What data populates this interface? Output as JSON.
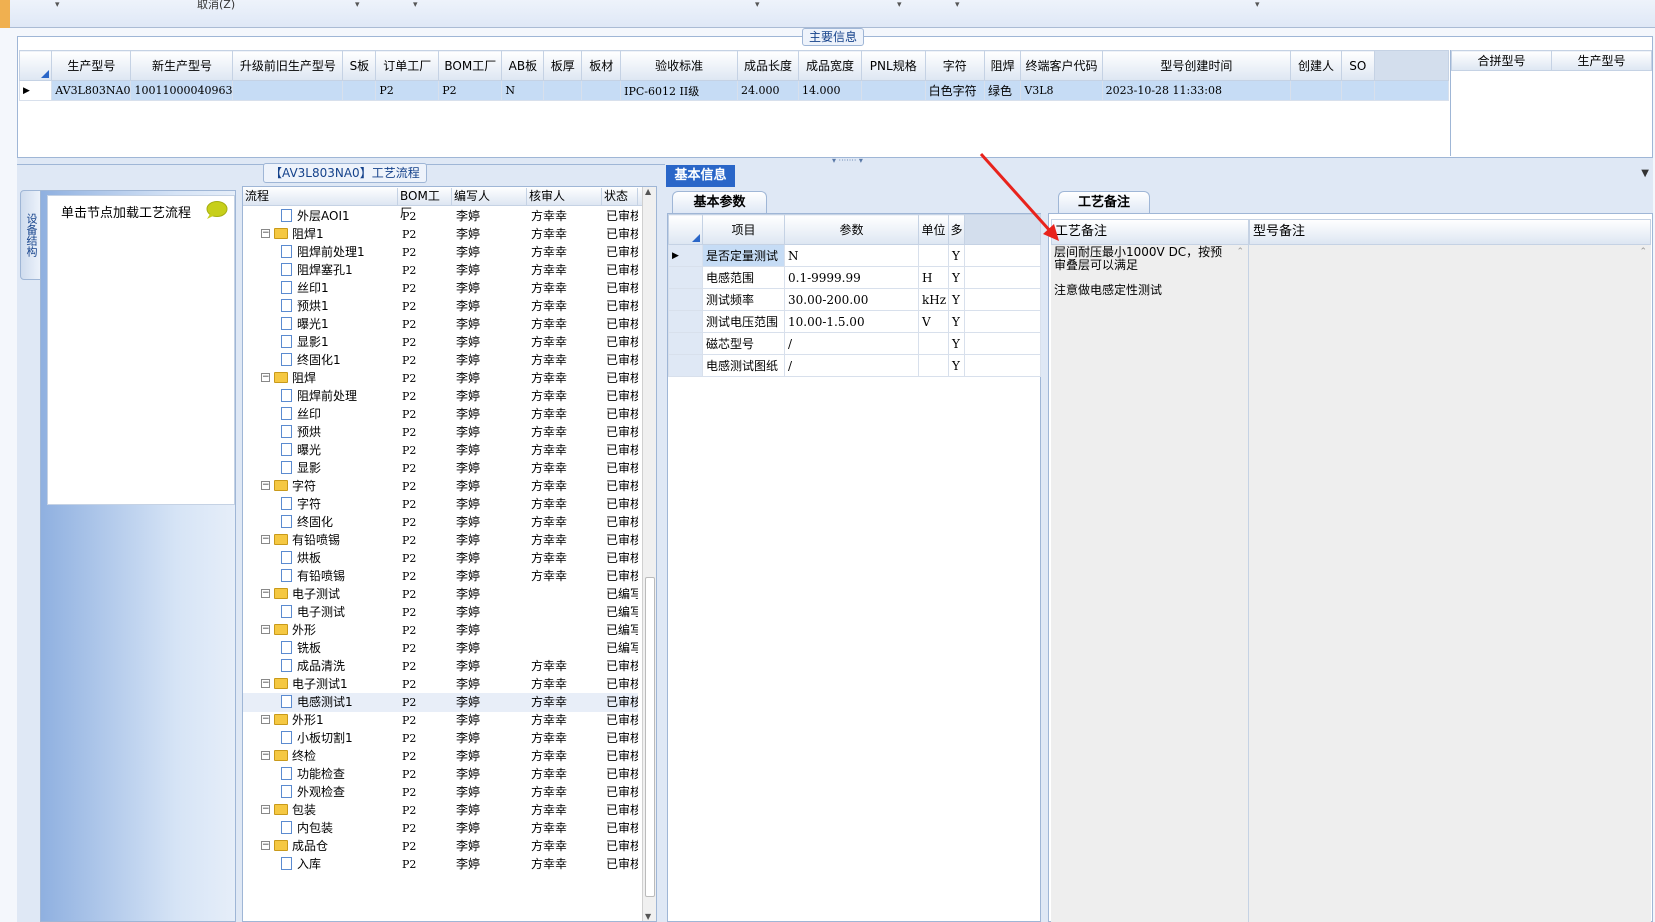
{
  "toolbar": {
    "cancel_label": "取消(Z)"
  },
  "main_info": {
    "title": "主要信息",
    "columns": [
      "生产型号",
      "新生产型号",
      "升级前旧生产型号",
      "S板",
      "订单工厂",
      "BOM工厂",
      "AB板",
      "板厚",
      "板材",
      "验收标准",
      "成品长度",
      "成品宽度",
      "PNL规格",
      "字符",
      "阻焊",
      "终端客户代码",
      "型号创建时间",
      "创建人",
      "SO"
    ],
    "row": [
      "AV3L803NA0",
      "10011000040963",
      "",
      "",
      "P2",
      "P2",
      "N",
      "",
      "",
      "IPC-6012 II级",
      "24.000",
      "14.000",
      "",
      "白色字符",
      "绿色",
      "V3L8",
      "2023-10-28 11:33:08",
      "",
      ""
    ],
    "merge_columns": [
      "合拼型号",
      "生产型号"
    ]
  },
  "side": {
    "vertical_tab": "设备结构",
    "load_label": "单击节点加载工艺流程"
  },
  "tree": {
    "title": "【AV3L803NA0】工艺流程",
    "columns": [
      "流程",
      "BOM工厂",
      "编写人",
      "核审人",
      "状态"
    ],
    "rows": [
      {
        "name": "外层AOI1",
        "level": 2,
        "folder": false,
        "bom": "P2",
        "writer": "李婷",
        "reviewer": "方幸幸",
        "status": "已审核"
      },
      {
        "name": "阻焊1",
        "level": 1,
        "folder": true,
        "bom": "P2",
        "writer": "李婷",
        "reviewer": "方幸幸",
        "status": "已审核"
      },
      {
        "name": "阻焊前处理1",
        "level": 2,
        "folder": false,
        "bom": "P2",
        "writer": "李婷",
        "reviewer": "方幸幸",
        "status": "已审核"
      },
      {
        "name": "阻焊塞孔1",
        "level": 2,
        "folder": false,
        "bom": "P2",
        "writer": "李婷",
        "reviewer": "方幸幸",
        "status": "已审核"
      },
      {
        "name": "丝印1",
        "level": 2,
        "folder": false,
        "bom": "P2",
        "writer": "李婷",
        "reviewer": "方幸幸",
        "status": "已审核"
      },
      {
        "name": "预烘1",
        "level": 2,
        "folder": false,
        "bom": "P2",
        "writer": "李婷",
        "reviewer": "方幸幸",
        "status": "已审核"
      },
      {
        "name": "曝光1",
        "level": 2,
        "folder": false,
        "bom": "P2",
        "writer": "李婷",
        "reviewer": "方幸幸",
        "status": "已审核"
      },
      {
        "name": "显影1",
        "level": 2,
        "folder": false,
        "bom": "P2",
        "writer": "李婷",
        "reviewer": "方幸幸",
        "status": "已审核"
      },
      {
        "name": "终固化1",
        "level": 2,
        "folder": false,
        "bom": "P2",
        "writer": "李婷",
        "reviewer": "方幸幸",
        "status": "已审核"
      },
      {
        "name": "阻焊",
        "level": 1,
        "folder": true,
        "bom": "P2",
        "writer": "李婷",
        "reviewer": "方幸幸",
        "status": "已审核"
      },
      {
        "name": "阻焊前处理",
        "level": 2,
        "folder": false,
        "bom": "P2",
        "writer": "李婷",
        "reviewer": "方幸幸",
        "status": "已审核"
      },
      {
        "name": "丝印",
        "level": 2,
        "folder": false,
        "bom": "P2",
        "writer": "李婷",
        "reviewer": "方幸幸",
        "status": "已审核"
      },
      {
        "name": "预烘",
        "level": 2,
        "folder": false,
        "bom": "P2",
        "writer": "李婷",
        "reviewer": "方幸幸",
        "status": "已审核"
      },
      {
        "name": "曝光",
        "level": 2,
        "folder": false,
        "bom": "P2",
        "writer": "李婷",
        "reviewer": "方幸幸",
        "status": "已审核"
      },
      {
        "name": "显影",
        "level": 2,
        "folder": false,
        "bom": "P2",
        "writer": "李婷",
        "reviewer": "方幸幸",
        "status": "已审核"
      },
      {
        "name": "字符",
        "level": 1,
        "folder": true,
        "bom": "P2",
        "writer": "李婷",
        "reviewer": "方幸幸",
        "status": "已审核"
      },
      {
        "name": "字符",
        "level": 2,
        "folder": false,
        "bom": "P2",
        "writer": "李婷",
        "reviewer": "方幸幸",
        "status": "已审核"
      },
      {
        "name": "终固化",
        "level": 2,
        "folder": false,
        "bom": "P2",
        "writer": "李婷",
        "reviewer": "方幸幸",
        "status": "已审核"
      },
      {
        "name": "有铅喷锡",
        "level": 1,
        "folder": true,
        "bom": "P2",
        "writer": "李婷",
        "reviewer": "方幸幸",
        "status": "已审核"
      },
      {
        "name": "烘板",
        "level": 2,
        "folder": false,
        "bom": "P2",
        "writer": "李婷",
        "reviewer": "方幸幸",
        "status": "已审核"
      },
      {
        "name": "有铅喷锡",
        "level": 2,
        "folder": false,
        "bom": "P2",
        "writer": "李婷",
        "reviewer": "方幸幸",
        "status": "已审核"
      },
      {
        "name": "电子测试",
        "level": 1,
        "folder": true,
        "bom": "P2",
        "writer": "李婷",
        "reviewer": "",
        "status": "已编写"
      },
      {
        "name": "电子测试",
        "level": 2,
        "folder": false,
        "bom": "P2",
        "writer": "李婷",
        "reviewer": "",
        "status": "已编写"
      },
      {
        "name": "外形",
        "level": 1,
        "folder": true,
        "bom": "P2",
        "writer": "李婷",
        "reviewer": "",
        "status": "已编写"
      },
      {
        "name": "铣板",
        "level": 2,
        "folder": false,
        "bom": "P2",
        "writer": "李婷",
        "reviewer": "",
        "status": "已编写"
      },
      {
        "name": "成品清洗",
        "level": 2,
        "folder": false,
        "bom": "P2",
        "writer": "李婷",
        "reviewer": "方幸幸",
        "status": "已审核"
      },
      {
        "name": "电子测试1",
        "level": 1,
        "folder": true,
        "bom": "P2",
        "writer": "李婷",
        "reviewer": "方幸幸",
        "status": "已审核"
      },
      {
        "name": "电感测试1",
        "level": 2,
        "folder": false,
        "bom": "P2",
        "writer": "李婷",
        "reviewer": "方幸幸",
        "status": "已审核",
        "selected": true
      },
      {
        "name": "外形1",
        "level": 1,
        "folder": true,
        "bom": "P2",
        "writer": "李婷",
        "reviewer": "方幸幸",
        "status": "已审核"
      },
      {
        "name": "小板切割1",
        "level": 2,
        "folder": false,
        "bom": "P2",
        "writer": "李婷",
        "reviewer": "方幸幸",
        "status": "已审核"
      },
      {
        "name": "终检",
        "level": 1,
        "folder": true,
        "bom": "P2",
        "writer": "李婷",
        "reviewer": "方幸幸",
        "status": "已审核"
      },
      {
        "name": "功能检查",
        "level": 2,
        "folder": false,
        "bom": "P2",
        "writer": "李婷",
        "reviewer": "方幸幸",
        "status": "已审核"
      },
      {
        "name": "外观检查",
        "level": 2,
        "folder": false,
        "bom": "P2",
        "writer": "李婷",
        "reviewer": "方幸幸",
        "status": "已审核"
      },
      {
        "name": "包装",
        "level": 1,
        "folder": true,
        "bom": "P2",
        "writer": "李婷",
        "reviewer": "方幸幸",
        "status": "已审核"
      },
      {
        "name": "内包装",
        "level": 2,
        "folder": false,
        "bom": "P2",
        "writer": "李婷",
        "reviewer": "方幸幸",
        "status": "已审核"
      },
      {
        "name": "成品仓",
        "level": 1,
        "folder": true,
        "bom": "P2",
        "writer": "李婷",
        "reviewer": "方幸幸",
        "status": "已审核"
      },
      {
        "name": "入库",
        "level": 2,
        "folder": false,
        "bom": "P2",
        "writer": "李婷",
        "reviewer": "方幸幸",
        "status": "已审核"
      }
    ]
  },
  "basic_info": {
    "tab": "基本信息",
    "params_tab": "基本参数",
    "columns": [
      "项目",
      "参数",
      "单位",
      "多"
    ],
    "rows": [
      {
        "item": "是否定量测试",
        "param": "N",
        "unit": "",
        "flag": "Y"
      },
      {
        "item": "电感范围",
        "param": "0.1-9999.99",
        "unit": "H",
        "flag": "Y"
      },
      {
        "item": "测试频率",
        "param": "30.00-200.00",
        "unit": "kHz",
        "flag": "Y"
      },
      {
        "item": "测试电压范围",
        "param": "10.00-1.5.00",
        "unit": "V",
        "flag": "Y"
      },
      {
        "item": "磁芯型号",
        "param": "/",
        "unit": "",
        "flag": "Y"
      },
      {
        "item": "电感测试图纸",
        "param": "/",
        "unit": "",
        "flag": "Y"
      }
    ]
  },
  "notes": {
    "tab": "工艺备注",
    "col1": "工艺备注",
    "col2": "型号备注",
    "note1": "层间耐压最小1000V DC，按预审叠层可以满足",
    "note2": "注意做电感定性测试"
  },
  "colors": {
    "accent_tab": "#2a66c8",
    "selection": "#c6dcf5",
    "arrow": "#e8231c",
    "border": "#9fb6d6"
  }
}
